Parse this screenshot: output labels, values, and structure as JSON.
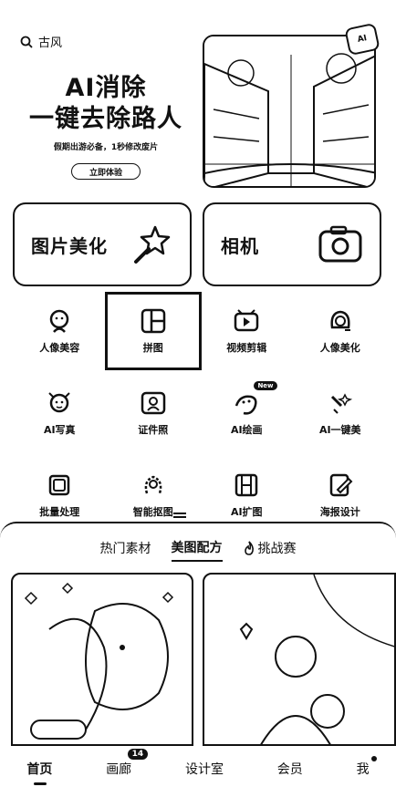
{
  "search": {
    "text": "古风"
  },
  "banner": {
    "title_line1": "AI消除",
    "title_line2": "一键去除路人",
    "subtitle": "假期出游必备，1秒修改废片",
    "button": "立即体验"
  },
  "features": [
    {
      "label": "图片美化"
    },
    {
      "label": "相机"
    }
  ],
  "tools": [
    {
      "label": "人像美容",
      "icon": "face-icon"
    },
    {
      "label": "拼图",
      "icon": "collage-icon"
    },
    {
      "label": "视频剪辑",
      "icon": "video-icon"
    },
    {
      "label": "人像美化",
      "icon": "portrait-icon"
    },
    {
      "label": "AI写真",
      "icon": "ai-portrait-icon"
    },
    {
      "label": "证件照",
      "icon": "id-photo-icon"
    },
    {
      "label": "AI绘画",
      "icon": "ai-paint-icon",
      "badge": "New"
    },
    {
      "label": "AI一键美",
      "icon": "magic-icon"
    },
    {
      "label": "批量处理",
      "icon": "batch-icon"
    },
    {
      "label": "智能抠图",
      "icon": "cutout-icon"
    },
    {
      "label": "AI扩图",
      "icon": "expand-icon"
    },
    {
      "label": "海报设计",
      "icon": "poster-icon"
    }
  ],
  "content_tabs": [
    "热门素材",
    "美图配方",
    "挑战赛"
  ],
  "active_tab": "美图配方",
  "nav": [
    {
      "label": "首页"
    },
    {
      "label": "画廊",
      "badge": "14"
    },
    {
      "label": "设计室"
    },
    {
      "label": "会员"
    },
    {
      "label": "我"
    }
  ]
}
